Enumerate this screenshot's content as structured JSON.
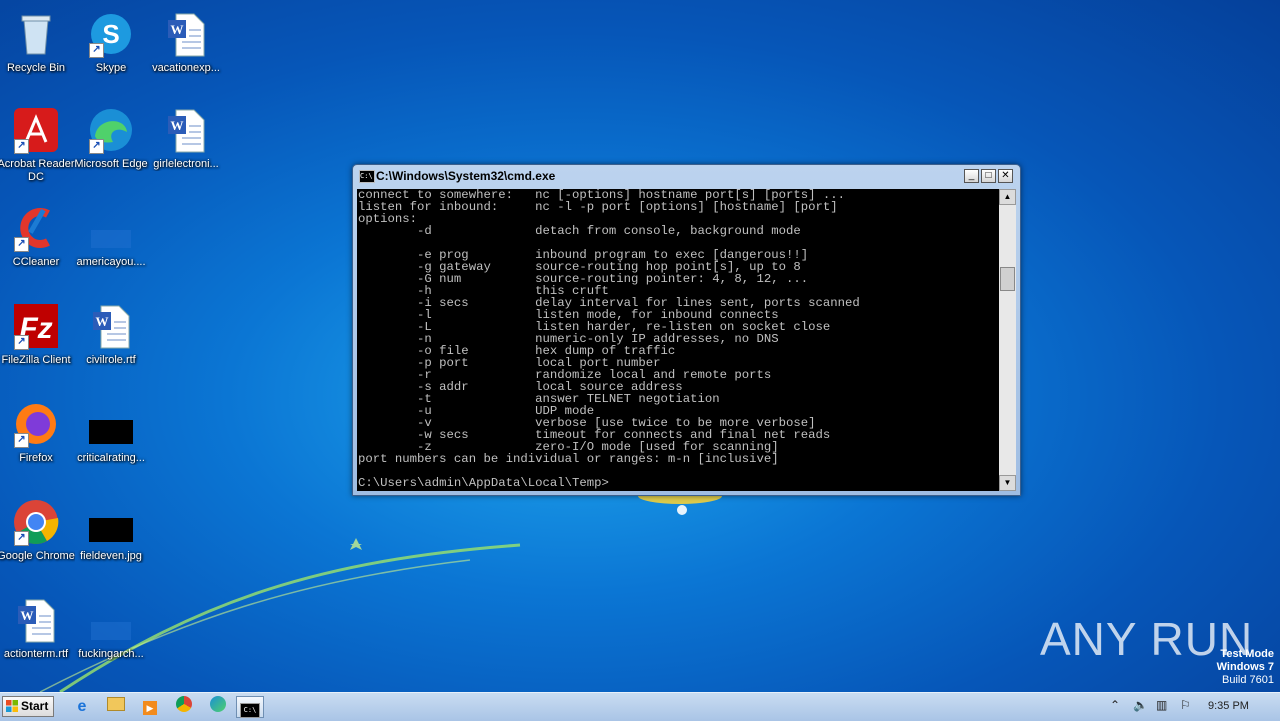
{
  "desktop": {
    "icons": [
      {
        "label": "Recycle Bin",
        "icon": "recycle-bin-icon"
      },
      {
        "label": "Skype",
        "icon": "skype-icon"
      },
      {
        "label": "vacationexp...",
        "icon": "word-doc-icon"
      },
      {
        "label": "Acrobat Reader DC",
        "icon": "acrobat-icon"
      },
      {
        "label": "Microsoft Edge",
        "icon": "edge-icon"
      },
      {
        "label": "girlelectroni...",
        "icon": "word-doc-icon"
      },
      {
        "label": "CCleaner",
        "icon": "ccleaner-icon"
      },
      {
        "label": "americayou....",
        "icon": "folder-file-icon"
      },
      {
        "label": "FileZilla Client",
        "icon": "filezilla-icon"
      },
      {
        "label": "civilrole.rtf",
        "icon": "word-doc-icon"
      },
      {
        "label": "Firefox",
        "icon": "firefox-icon"
      },
      {
        "label": "criticalrating...",
        "icon": "black-file-icon"
      },
      {
        "label": "Google Chrome",
        "icon": "chrome-icon"
      },
      {
        "label": "fieldeven.jpg",
        "icon": "black-file-icon"
      },
      {
        "label": "actionterm.rtf",
        "icon": "word-doc-icon"
      },
      {
        "label": "fuckingarch...",
        "icon": "folder-file-icon"
      }
    ]
  },
  "cmd_window": {
    "title": "C:\\Windows\\System32\\cmd.exe",
    "minimize": "_",
    "maximize": "□",
    "close": "✕",
    "output": "connect to somewhere:   nc [-options] hostname port[s] [ports] ...\nlisten for inbound:     nc -l -p port [options] [hostname] [port]\noptions:\n        -d              detach from console, background mode\n\n        -e prog         inbound program to exec [dangerous!!]\n        -g gateway      source-routing hop point[s], up to 8\n        -G num          source-routing pointer: 4, 8, 12, ...\n        -h              this cruft\n        -i secs         delay interval for lines sent, ports scanned\n        -l              listen mode, for inbound connects\n        -L              listen harder, re-listen on socket close\n        -n              numeric-only IP addresses, no DNS\n        -o file         hex dump of traffic\n        -p port         local port number\n        -r              randomize local and remote ports\n        -s addr         local source address\n        -t              answer TELNET negotiation\n        -u              UDP mode\n        -v              verbose [use twice to be more verbose]\n        -w secs         timeout for connects and final net reads\n        -z              zero-I/O mode [used for scanning]\nport numbers can be individual or ranges: m-n [inclusive]\n\nC:\\Users\\admin\\AppData\\Local\\Temp>"
  },
  "taskbar": {
    "start_label": "Start",
    "pinned": [
      "ie-icon",
      "explorer-icon",
      "media-player-icon",
      "chrome-icon",
      "edge-icon",
      "cmd-icon"
    ],
    "clock": "9:35 PM"
  },
  "watermark": {
    "brand": "ANY RUN",
    "test_mode": "Test Mode",
    "os": "Windows 7",
    "build": "Build 7601"
  }
}
